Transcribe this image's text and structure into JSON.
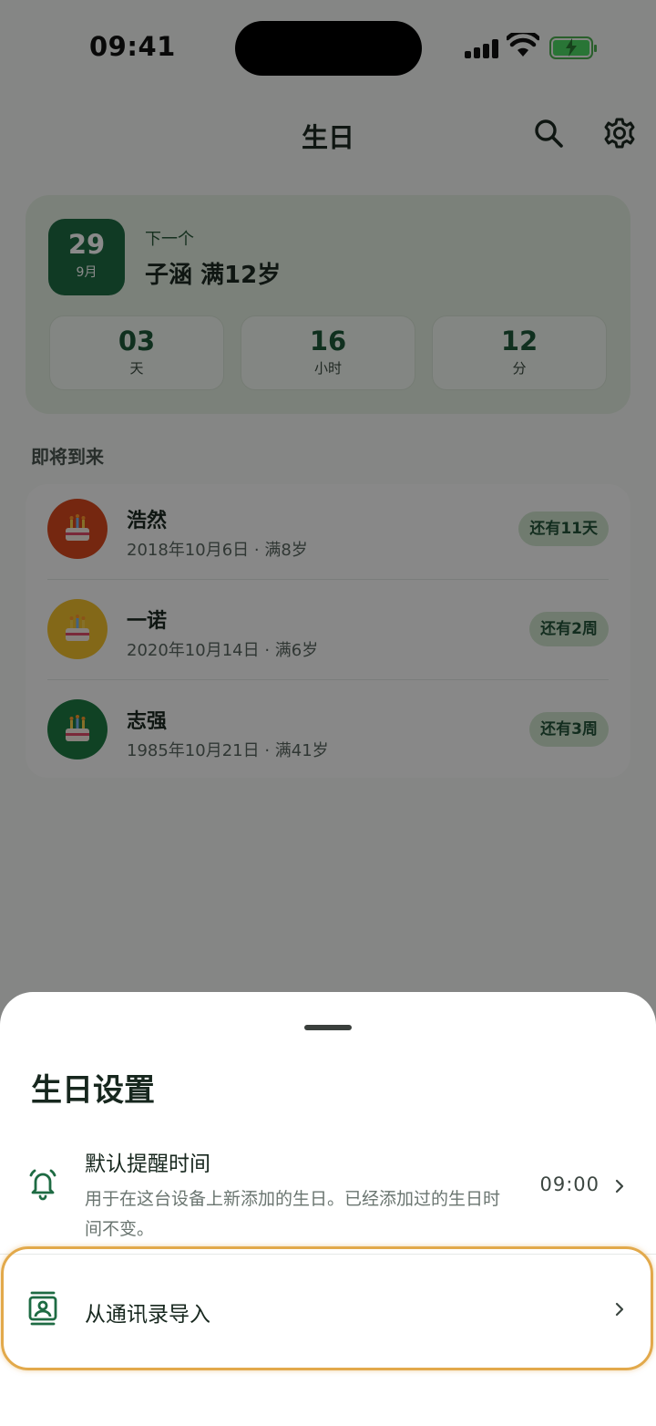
{
  "status_bar": {
    "time": "09:41"
  },
  "header": {
    "title": "生日",
    "search_icon": "search-icon",
    "settings_icon": "gear-icon"
  },
  "next_birthday": {
    "day": "29",
    "month": "9月",
    "label": "下一个",
    "name": "子涵 满12岁",
    "countdown": [
      {
        "value": "03",
        "unit": "天"
      },
      {
        "value": "16",
        "unit": "小时"
      },
      {
        "value": "12",
        "unit": "分"
      }
    ]
  },
  "upcoming": {
    "title": "即将到来",
    "items": [
      {
        "name": "浩然",
        "sub": "2018年10月6日 · 满8岁",
        "badge": "还有11天",
        "avatar_color": "#d9481f"
      },
      {
        "name": "一诺",
        "sub": "2020年10月14日 · 满6岁",
        "badge": "还有2周",
        "avatar_color": "#f2c12e"
      },
      {
        "name": "志强",
        "sub": "1985年10月21日 · 满41岁",
        "badge": "还有3周",
        "avatar_color": "#1e7a44"
      }
    ]
  },
  "sheet": {
    "title": "生日设置",
    "reminder": {
      "title": "默认提醒时间",
      "desc": "用于在这台设备上新添加的生日。已经添加过的生日时间不变。",
      "value": "09:00",
      "icon": "bell-icon"
    },
    "import": {
      "title": "从通讯录导入",
      "icon": "contact-card-icon"
    }
  },
  "colors": {
    "brand_green": "#1e6b43",
    "highlight": "#e2a94b"
  }
}
